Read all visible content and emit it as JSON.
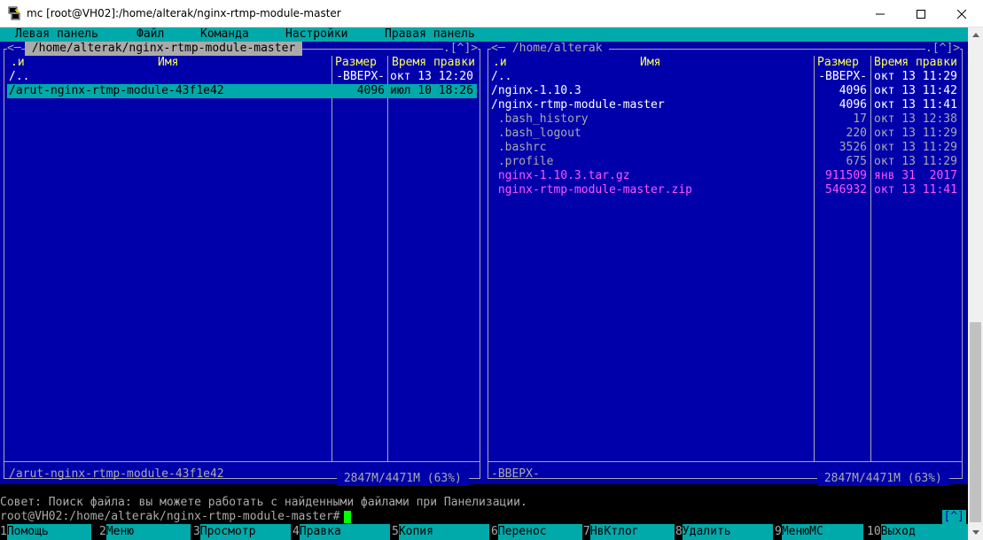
{
  "window": {
    "title": "mc [root@VH02]:/home/alterak/nginx-rtmp-module-master"
  },
  "menu": [
    "Левая панель",
    "Файл",
    "Команда",
    "Настройки",
    "Правая панель"
  ],
  "left_panel": {
    "path": " /home/alterak/nginx-rtmp-module-master ",
    "corner": ".[^]>",
    "col_sort": ".и",
    "col_name": "Имя",
    "col_size": "Размер",
    "col_time": "Время правки",
    "rows": [
      {
        "name": "/..",
        "size": "-ВВЕРХ-",
        "time": "окт 13 12:20",
        "style": "white"
      },
      {
        "name": "/arut-nginx-rtmp-module-43f1e42",
        "size": "4096",
        "time": "июл 10 18:26",
        "style": "selected"
      }
    ],
    "mini_status": "/arut-nginx-rtmp-module-43f1e42",
    "footer": " 2847M/4471M (63%) "
  },
  "right_panel": {
    "path": " /home/alterak ",
    "corner": ".[^]>",
    "col_sort": ".и",
    "col_name": "Имя",
    "col_size": "Размер",
    "col_time": "Время правки",
    "rows": [
      {
        "name": "/..",
        "size": "-ВВЕРХ-",
        "time": "окт 13 11:29",
        "style": "white"
      },
      {
        "name": "/nginx-1.10.3",
        "size": "4096",
        "time": "окт 13 11:42",
        "style": "white"
      },
      {
        "name": "/nginx-rtmp-module-master",
        "size": "4096",
        "time": "окт 13 11:41",
        "style": "white"
      },
      {
        "name": " .bash_history",
        "size": "17",
        "time": "окт 13 12:38",
        "style": "gray"
      },
      {
        "name": " .bash_logout",
        "size": "220",
        "time": "окт 13 11:29",
        "style": "gray"
      },
      {
        "name": " .bashrc",
        "size": "3526",
        "time": "окт 13 11:29",
        "style": "gray"
      },
      {
        "name": " .profile",
        "size": "675",
        "time": "окт 13 11:29",
        "style": "gray"
      },
      {
        "name": " nginx-1.10.3.tar.gz",
        "size": "911509",
        "time": "янв 31  2017",
        "style": "magenta"
      },
      {
        "name": " nginx-rtmp-module-master.zip",
        "size": "546932",
        "time": "окт 13 11:41",
        "style": "magenta"
      }
    ],
    "mini_status": "-ВВЕРХ-",
    "footer": " 2847M/4471M (63%) "
  },
  "hint": "Совет: Поиск файла: вы можете работать с найденными файлами при Панелизации.",
  "prompt": "root@VH02:/home/alterak/nginx-rtmp-module-master#",
  "cmd_corner": "[^]",
  "fkeys": [
    {
      "num": "1",
      "label": "Помощь"
    },
    {
      "num": "2",
      "label": "Меню"
    },
    {
      "num": "3",
      "label": "Просмотр"
    },
    {
      "num": "4",
      "label": "Правка"
    },
    {
      "num": "5",
      "label": "Копия"
    },
    {
      "num": "6",
      "label": "Перенос"
    },
    {
      "num": "7",
      "label": "НвКтлог"
    },
    {
      "num": "8",
      "label": "Удалить"
    },
    {
      "num": "9",
      "label": "МенюMC"
    },
    {
      "num": "10",
      "label": "Выход"
    }
  ],
  "icons": {
    "app": "putty-icon",
    "minimize": "minimize-icon",
    "maximize": "maximize-icon",
    "close": "close-icon"
  }
}
